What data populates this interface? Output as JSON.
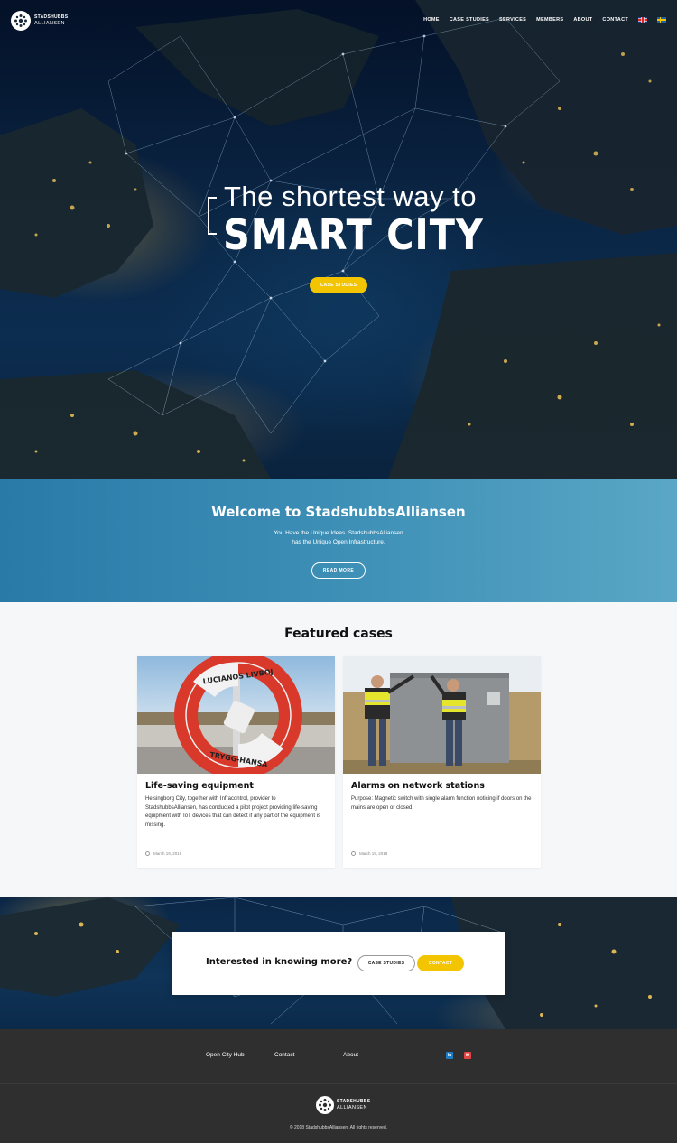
{
  "brand": {
    "line1": "STADSHUBBS",
    "line2": "ALLIANSEN"
  },
  "nav": {
    "items": [
      "HOME",
      "CASE STUDIES",
      "SERVICES",
      "MEMBERS",
      "ABOUT",
      "CONTACT"
    ],
    "languages": [
      "English",
      "Svenska"
    ]
  },
  "hero": {
    "line1": "The shortest way to",
    "line2": "SMART CITY",
    "button": "CASE STUDIES"
  },
  "welcome": {
    "title": "Welcome to StadshubbsAlliansen",
    "line1": "You Have the Unique Ideas. StadshubbsAlliansen",
    "line2": "has the Unique Open Infrastructure.",
    "button": "READ MORE"
  },
  "featured": {
    "title": "Featured cases",
    "cards": [
      {
        "title": "Life-saving equipment",
        "text": "Helsingborg City, together with Infracontrol, provider to StadshubbsAlliansen, has conducted a pilot project providing life-saving equipment with IoT devices that can detect if any part of the equipment is missing.",
        "date": "March 19, 2018",
        "image_text_top": "LUCIANOS LIVBOJ",
        "image_text_bottom": "TRYGG-HANSA"
      },
      {
        "title": "Alarms on network stations",
        "text": "Purpose: Magnetic switch with single alarm function noticing if doors on the mains are open or closed.",
        "date": "March 19, 2018"
      }
    ]
  },
  "cta": {
    "text": "Interested in knowing more?",
    "button1": "CASE STUDIES",
    "button2": "CONTACT"
  },
  "footer": {
    "links": [
      "Open City Hub",
      "Contact",
      "About"
    ],
    "social": {
      "linkedin": "in",
      "mail": "✉"
    },
    "copyright": "© 2018 StadshubbsAlliansen. All rights reserved."
  },
  "colors": {
    "accent": "#f2c500",
    "welcome": "#3d8fb6",
    "footer": "#2f2f2f"
  }
}
